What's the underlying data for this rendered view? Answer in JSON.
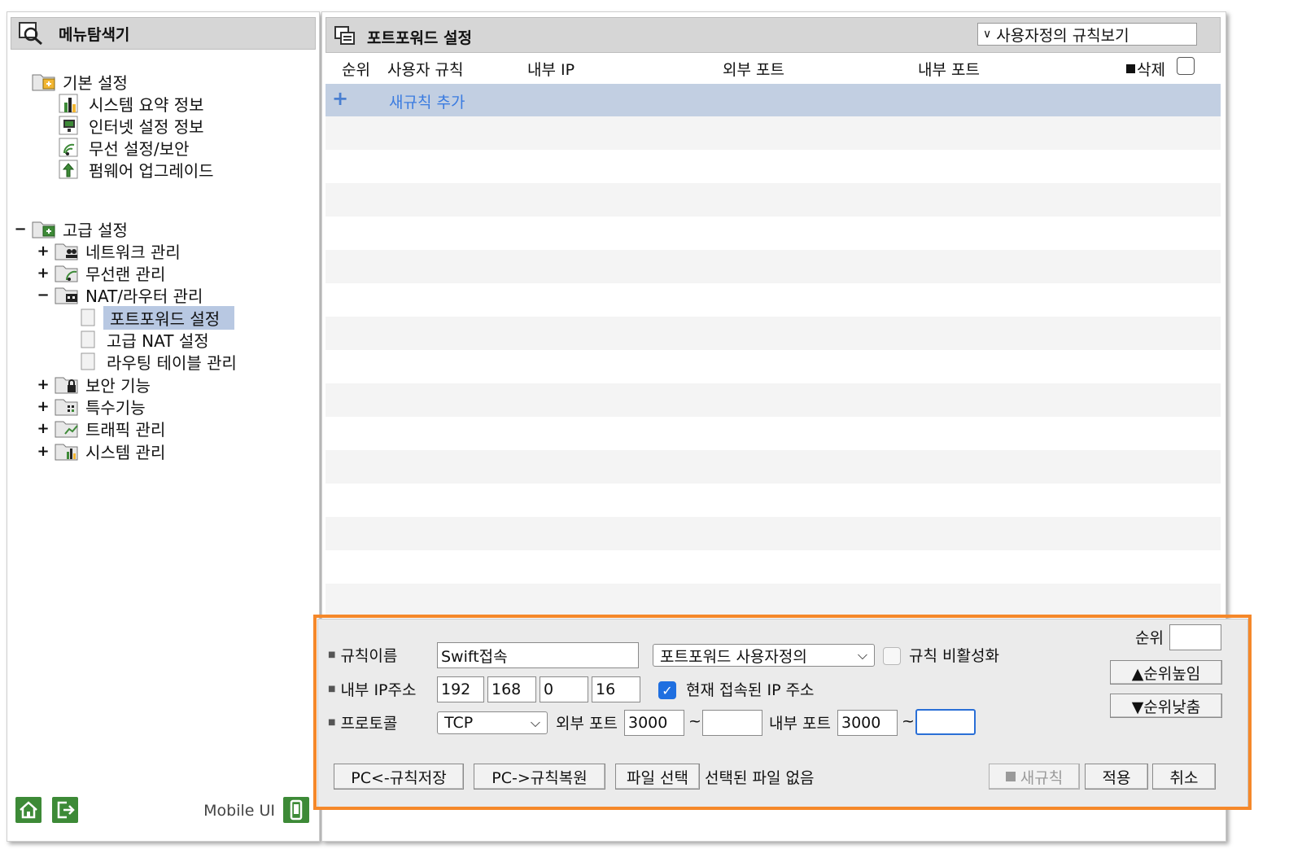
{
  "left": {
    "title": "메뉴탐색기",
    "tree": {
      "basic": {
        "label": "기본 설정",
        "items": [
          "시스템 요약 정보",
          "인터넷 설정 정보",
          "무선 설정/보안",
          "펌웨어 업그레이드"
        ]
      },
      "advanced": {
        "toggle": "−",
        "label": "고급 설정",
        "items": [
          {
            "toggle": "+",
            "label": "네트워크 관리"
          },
          {
            "toggle": "+",
            "label": "무선랜 관리"
          },
          {
            "toggle": "−",
            "label": "NAT/라우터 관리",
            "children": [
              "포트포워드 설정",
              "고급 NAT 설정",
              "라우팅 테이블 관리"
            ]
          },
          {
            "toggle": "+",
            "label": "보안 기능"
          },
          {
            "toggle": "+",
            "label": "특수기능"
          },
          {
            "toggle": "+",
            "label": "트래픽 관리"
          },
          {
            "toggle": "+",
            "label": "시스템 관리"
          }
        ]
      }
    },
    "footer": {
      "mobile_label": "Mobile UI"
    }
  },
  "right": {
    "title": "포트포워드 설정",
    "view_select": "사용자정의 규칙보기",
    "columns": {
      "rank": "순위",
      "user_rule": "사용자 규칙",
      "internal_ip": "내부 IP",
      "external_port": "외부 포트",
      "internal_port": "내부 포트",
      "delete": "삭제"
    },
    "new_rule_plus": "+",
    "new_rule_label": "새규칙 추가"
  },
  "form": {
    "rule_name_label": "규칙이름",
    "rule_name_value": "Swift접속",
    "rule_type": "포트포워드 사용자정의",
    "disable_label": "규칙 비활성화",
    "rank_label": "순위",
    "rank_value": "",
    "ip_label": "내부 IP주소",
    "ip": [
      "192",
      "168",
      "0",
      "16"
    ],
    "current_ip_label": "현재 접속된 IP 주소",
    "protocol_label": "프로토콜",
    "protocol": "TCP",
    "ext_port_label": "외부 포트",
    "ext_port_start": "3000",
    "ext_port_end": "",
    "int_port_label": "내부 포트",
    "int_port_start": "3000",
    "int_port_end": "",
    "tilde": "~",
    "rank_up": "▲순위높임",
    "rank_down": "▼순위낮춤",
    "save_pc": "PC<-규칙저장",
    "restore_pc": "PC->규칙복원",
    "file_select": "파일 선택",
    "no_file": "선택된 파일 없음",
    "new_rule": "새규칙",
    "apply": "적용",
    "cancel": "취소"
  },
  "colors": {
    "accent_highlight": "#f5882a",
    "selected": "#b8c8e2",
    "new_rule_row": "#c2cfe2",
    "icon_green": "#3d8a37"
  }
}
